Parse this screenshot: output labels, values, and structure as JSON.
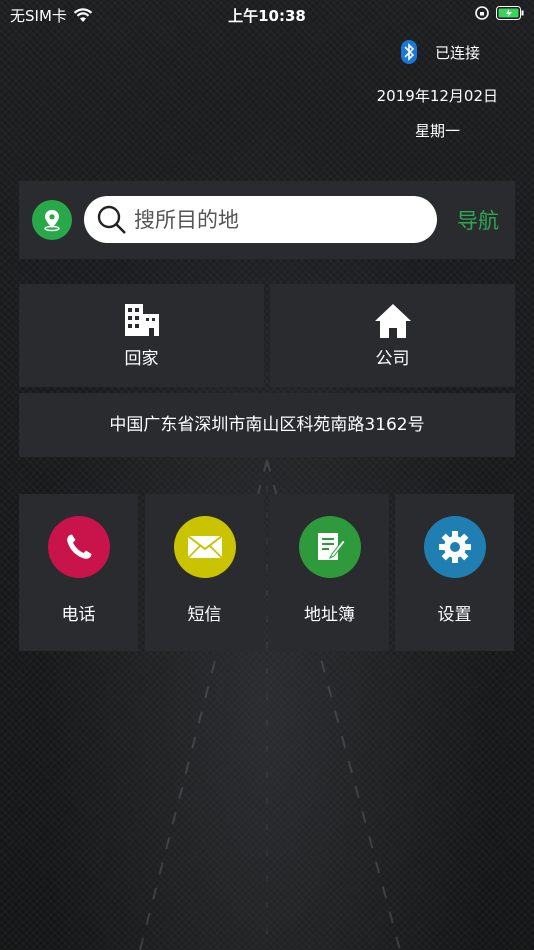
{
  "status_bar": {
    "carrier": "无SIM卡",
    "time": "上午10:38"
  },
  "bluetooth": {
    "status": "已连接",
    "icon": "bluetooth-icon"
  },
  "date": "2019年12月02日",
  "weekday": "星期一",
  "search": {
    "placeholder": "搜所目的地",
    "nav_label": "导航"
  },
  "shortcuts": [
    {
      "label": "回家",
      "icon": "building-icon"
    },
    {
      "label": "公司",
      "icon": "home-icon"
    }
  ],
  "address": "中国广东省深圳市南山区科苑南路3162号",
  "apps": [
    {
      "label": "电话",
      "icon": "phone-icon",
      "color": "#c8144b"
    },
    {
      "label": "短信",
      "icon": "mail-icon",
      "color": "#c9c300"
    },
    {
      "label": "地址簿",
      "icon": "notes-icon",
      "color": "#2e9a3b"
    },
    {
      "label": "设置",
      "icon": "gear-icon",
      "color": "#1f7fb3"
    }
  ],
  "colors": {
    "accent_green": "#2fa84f",
    "panel": "#2a2b2f"
  }
}
